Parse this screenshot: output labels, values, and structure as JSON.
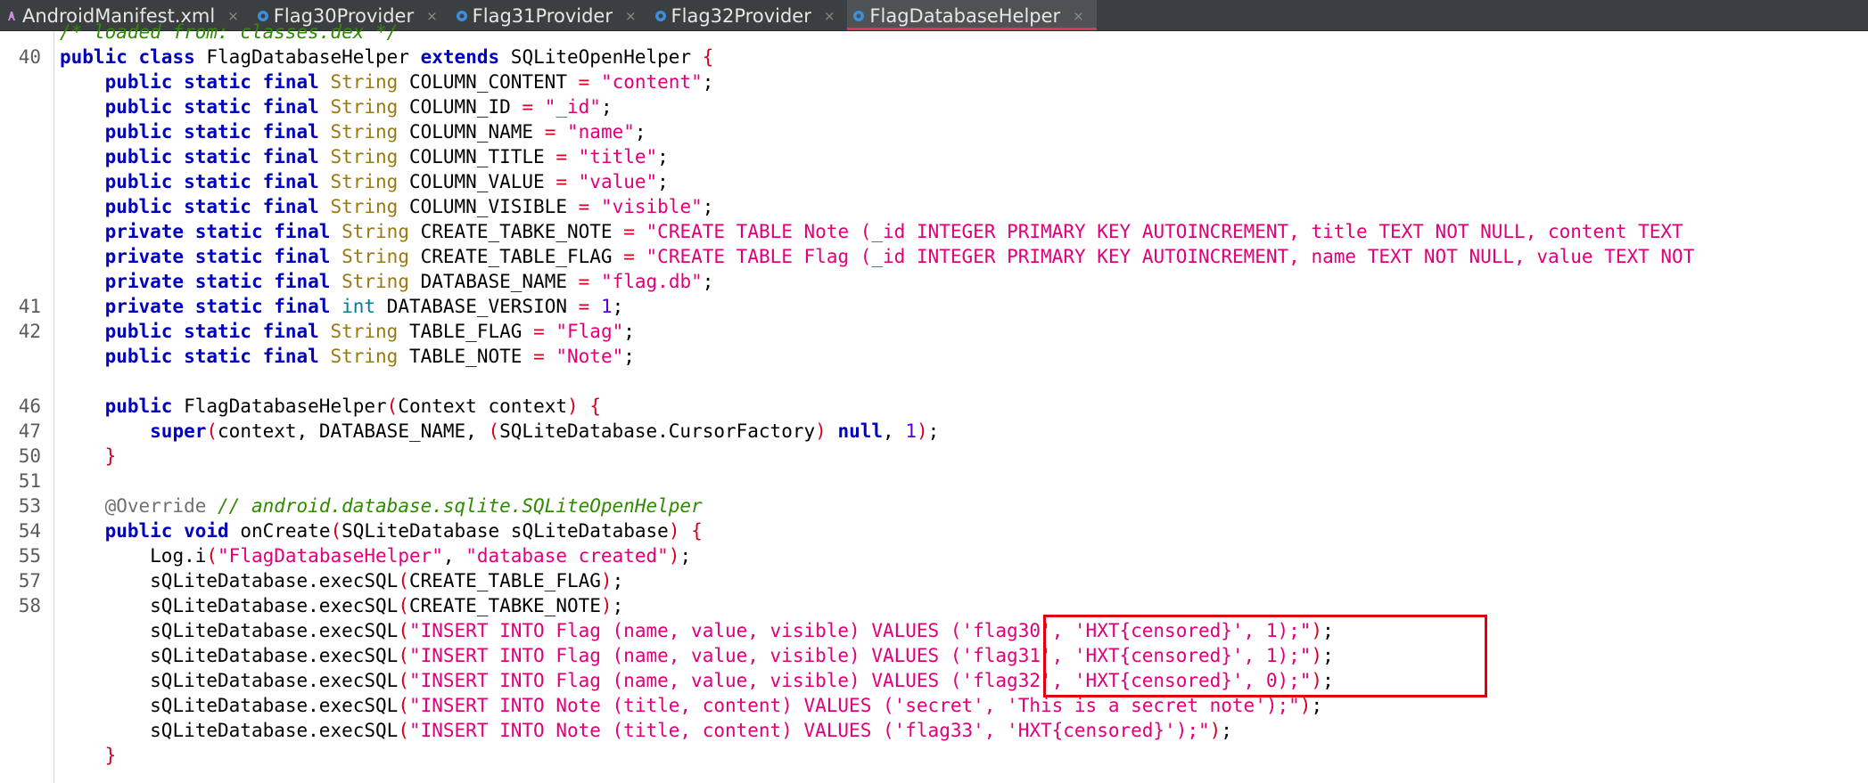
{
  "tabs": [
    {
      "label": "AndroidManifest.xml",
      "icon": "xml-file-icon",
      "active": false
    },
    {
      "label": "Flag30Provider",
      "icon": "java-class-icon",
      "active": false
    },
    {
      "label": "Flag31Provider",
      "icon": "java-class-icon",
      "active": false
    },
    {
      "label": "Flag32Provider",
      "icon": "java-class-icon",
      "active": false
    },
    {
      "label": "FlagDatabaseHelper",
      "icon": "java-class-icon",
      "active": true
    }
  ],
  "tab_close_glyph": "×",
  "colors": {
    "keyword": "#0000c0",
    "type": "#9a7a10",
    "string": "#e0007a",
    "number": "#5a00e0",
    "paren": "#d4001c",
    "comment": "#2e8b00",
    "highlight_box": "#e2000f",
    "active_tab_underline": "#d63a5a"
  },
  "top_comment": "/* loaded from: classes.dex */",
  "line_numbers": [
    "40",
    "41",
    "42",
    "46",
    "47",
    "50",
    "51",
    "53",
    "54",
    "55",
    "57",
    "58"
  ],
  "code": {
    "l40": {
      "public": "public",
      "class": "class",
      "name": "FlagDatabaseHelper",
      "extends": "extends",
      "parent": "SQLiteOpenHelper",
      "brace": "{"
    },
    "fields": [
      {
        "mods": "public static final",
        "type": "String",
        "name": "COLUMN_CONTENT",
        "value": "\"content\""
      },
      {
        "mods": "public static final",
        "type": "String",
        "name": "COLUMN_ID",
        "value": "\"_id\""
      },
      {
        "mods": "public static final",
        "type": "String",
        "name": "COLUMN_NAME",
        "value": "\"name\""
      },
      {
        "mods": "public static final",
        "type": "String",
        "name": "COLUMN_TITLE",
        "value": "\"title\""
      },
      {
        "mods": "public static final",
        "type": "String",
        "name": "COLUMN_VALUE",
        "value": "\"value\""
      },
      {
        "mods": "public static final",
        "type": "String",
        "name": "COLUMN_VISIBLE",
        "value": "\"visible\""
      },
      {
        "mods": "private static final",
        "type": "String",
        "name": "CREATE_TABKE_NOTE",
        "value": "\"CREATE TABLE Note (_id INTEGER PRIMARY KEY AUTOINCREMENT, title TEXT NOT NULL, content TEXT"
      },
      {
        "mods": "private static final",
        "type": "String",
        "name": "CREATE_TABLE_FLAG",
        "value": "\"CREATE TABLE Flag (_id INTEGER PRIMARY KEY AUTOINCREMENT, name TEXT NOT NULL, value TEXT NOT"
      },
      {
        "mods": "private static final",
        "type": "String",
        "name": "DATABASE_NAME",
        "value": "\"flag.db\""
      },
      {
        "mods": "private static final",
        "type": "int",
        "name": "DATABASE_VERSION",
        "value": "1"
      },
      {
        "mods": "public static final",
        "type": "String",
        "name": "TABLE_FLAG",
        "value": "\"Flag\""
      },
      {
        "mods": "public static final",
        "type": "String",
        "name": "TABLE_NOTE",
        "value": "\"Note\""
      }
    ],
    "ctor_sig": {
      "public": "public",
      "name": "FlagDatabaseHelper",
      "param_type": "Context",
      "param_name": "context"
    },
    "ctor_body": {
      "super": "super",
      "args1": "context, DATABASE_NAME, ",
      "cast": "SQLiteDatabase.CursorFactory",
      "null": "null",
      "one": "1"
    },
    "annotation": "@Override",
    "override_comment": "// android.database.sqlite.SQLiteOpenHelper",
    "oncreate_sig": {
      "mods": "public void",
      "name": "onCreate",
      "param_type": "SQLiteDatabase",
      "param_name": "sQLiteDatabase"
    },
    "log_call": {
      "obj": "Log.i",
      "tag": "\"FlagDatabaseHelper\"",
      "msg": "\"database created\""
    },
    "exec_lines": [
      {
        "prefix": "sQLiteDatabase.execSQL",
        "arg": "CREATE_TABLE_FLAG",
        "is_string": false
      },
      {
        "prefix": "sQLiteDatabase.execSQL",
        "arg": "CREATE_TABKE_NOTE",
        "is_string": false
      },
      {
        "prefix": "sQLiteDatabase.execSQL",
        "arg": "\"INSERT INTO Flag (name, value, visible) VALUES ('flag30', 'HXT{censored}', 1);\"",
        "is_string": true
      },
      {
        "prefix": "sQLiteDatabase.execSQL",
        "arg": "\"INSERT INTO Flag (name, value, visible) VALUES ('flag31', 'HXT{censored}', 1);\"",
        "is_string": true
      },
      {
        "prefix": "sQLiteDatabase.execSQL",
        "arg": "\"INSERT INTO Flag (name, value, visible) VALUES ('flag32', 'HXT{censored}', 0);\"",
        "is_string": true
      },
      {
        "prefix": "sQLiteDatabase.execSQL",
        "arg": "\"INSERT INTO Note (title, content) VALUES ('secret', 'This is a secret note');\"",
        "is_string": true
      },
      {
        "prefix": "sQLiteDatabase.execSQL",
        "arg": "\"INSERT INTO Note (title, content) VALUES ('flag33', 'HXT{censored}');\"",
        "is_string": true
      }
    ]
  }
}
